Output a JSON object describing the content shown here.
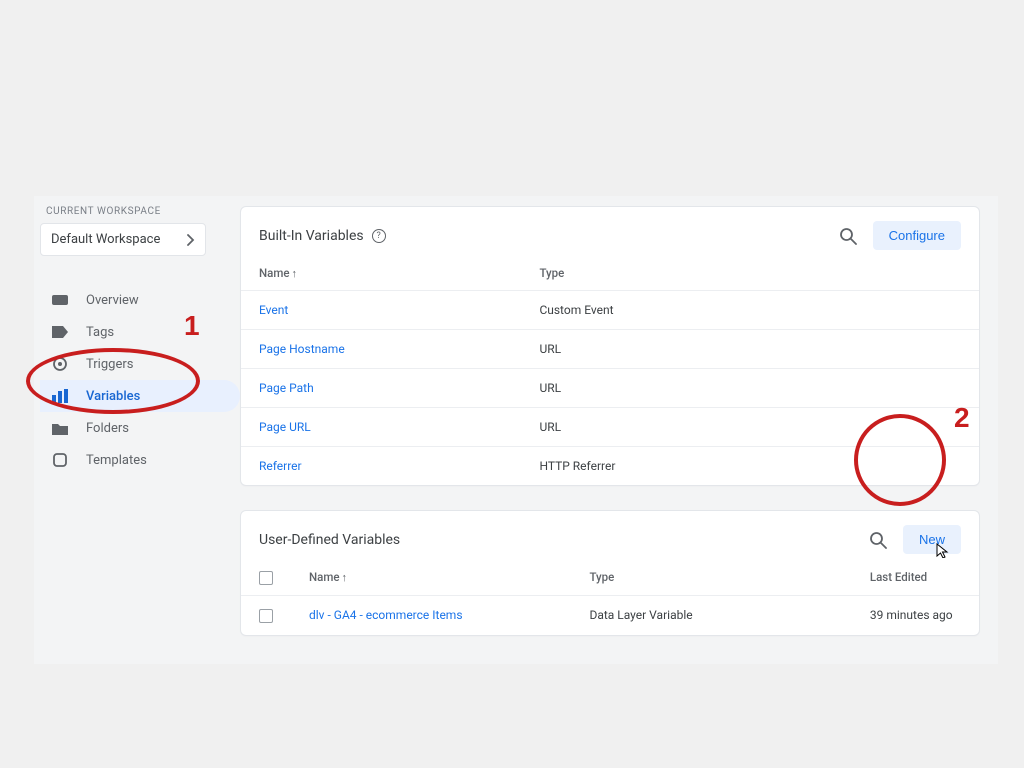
{
  "workspace": {
    "label": "CURRENT WORKSPACE",
    "selected": "Default Workspace"
  },
  "sidebar": {
    "items": [
      {
        "label": "Overview"
      },
      {
        "label": "Tags"
      },
      {
        "label": "Triggers"
      },
      {
        "label": "Variables"
      },
      {
        "label": "Folders"
      },
      {
        "label": "Templates"
      }
    ]
  },
  "builtin": {
    "title": "Built-In Variables",
    "configure_label": "Configure",
    "columns": {
      "name": "Name",
      "type": "Type"
    },
    "rows": [
      {
        "name": "Event",
        "type": "Custom Event"
      },
      {
        "name": "Page Hostname",
        "type": "URL"
      },
      {
        "name": "Page Path",
        "type": "URL"
      },
      {
        "name": "Page URL",
        "type": "URL"
      },
      {
        "name": "Referrer",
        "type": "HTTP Referrer"
      }
    ]
  },
  "userdef": {
    "title": "User-Defined Variables",
    "new_label": "New",
    "columns": {
      "name": "Name",
      "type": "Type",
      "last_edited": "Last Edited"
    },
    "rows": [
      {
        "name": "dlv - GA4 - ecommerce Items",
        "type": "Data Layer Variable",
        "last_edited": "39 minutes ago"
      }
    ]
  },
  "annotations": {
    "one": "1",
    "two": "2"
  }
}
